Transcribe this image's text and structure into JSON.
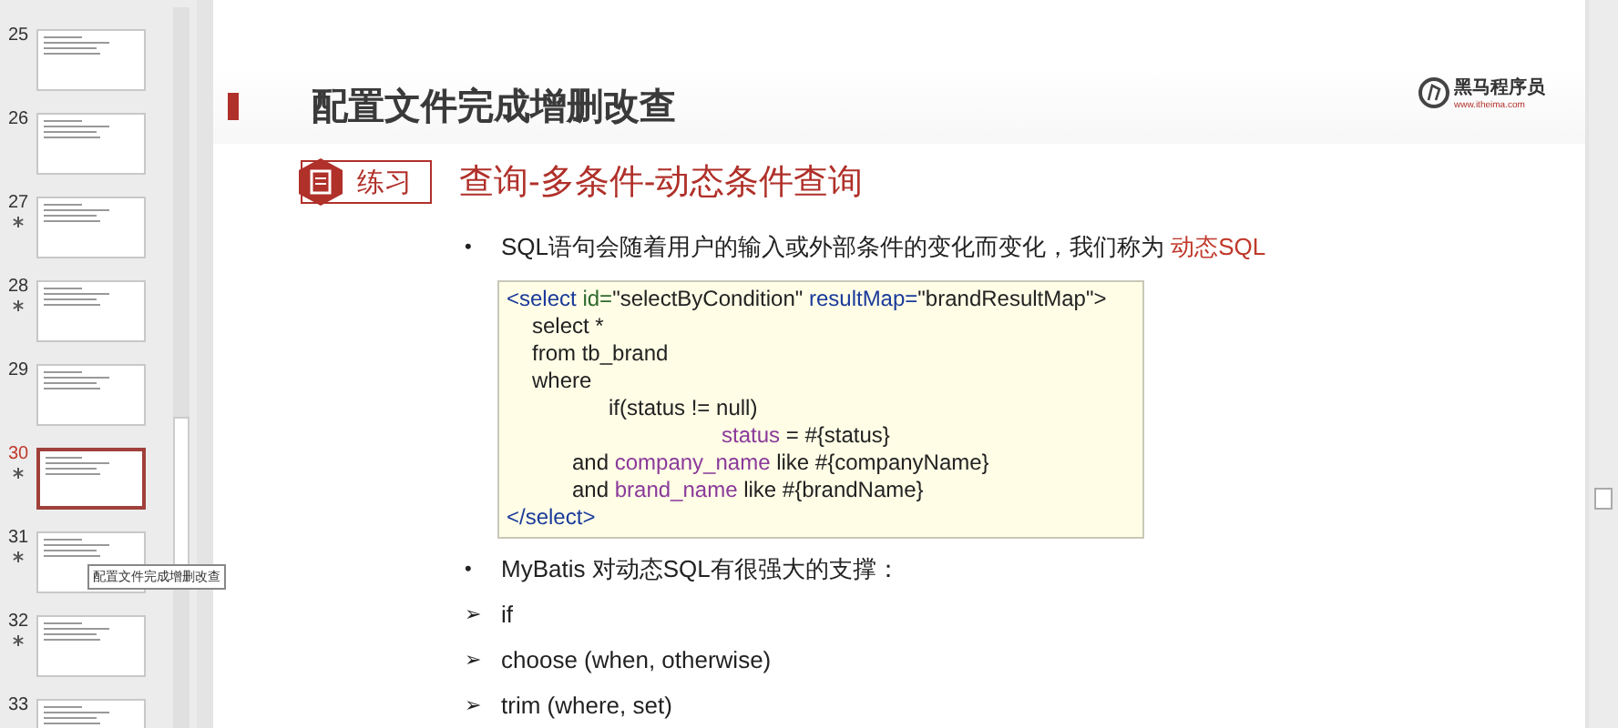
{
  "thumbnails": [
    {
      "number": "25",
      "starred": false,
      "selected": false
    },
    {
      "number": "26",
      "starred": false,
      "selected": false
    },
    {
      "number": "27",
      "starred": true,
      "selected": false
    },
    {
      "number": "28",
      "starred": true,
      "selected": false
    },
    {
      "number": "29",
      "starred": false,
      "selected": false
    },
    {
      "number": "30",
      "starred": true,
      "selected": true
    },
    {
      "number": "31",
      "starred": true,
      "selected": false
    },
    {
      "number": "32",
      "starred": true,
      "selected": false
    },
    {
      "number": "33",
      "starred": false,
      "selected": false
    }
  ],
  "tooltip": "配置文件完成增删改查",
  "slide": {
    "title": "配置文件完成增删改查",
    "logo": {
      "name": "黑马程序员",
      "url": "www.itheima.com"
    },
    "badge": "练习",
    "subtitle": "查询-多条件-动态条件查询",
    "intro": "SQL语句会随着用户的输入或外部条件的变化而变化，我们称为 ",
    "intro_highlight": "动态SQL",
    "code": [
      {
        "kind": "tag",
        "parts": [
          {
            "kind": "keyword",
            "text": "<select "
          },
          {
            "kind": "attr",
            "text": "id="
          },
          {
            "kind": "plain",
            "text": "\"selectByCondition\" "
          },
          {
            "kind": "keyword",
            "text": "resultMap="
          },
          {
            "kind": "plain",
            "text": "\"brandResultMap\">"
          }
        ]
      },
      {
        "kind": "body",
        "parts": [
          {
            "kind": "plain",
            "text": "select *"
          }
        ]
      },
      {
        "kind": "body",
        "parts": [
          {
            "kind": "plain",
            "text": "from tb_brand"
          }
        ]
      },
      {
        "kind": "body",
        "parts": [
          {
            "kind": "plain",
            "text": "where"
          }
        ]
      },
      {
        "kind": "condition",
        "parts": [
          {
            "kind": "plain",
            "text": "if(status != null)"
          }
        ]
      },
      {
        "kind": "value",
        "parts": [
          {
            "kind": "field",
            "text": "status"
          },
          {
            "kind": "plain",
            "text": " = #{status}"
          }
        ]
      },
      {
        "kind": "clause",
        "parts": [
          {
            "kind": "plain",
            "text": "and "
          },
          {
            "kind": "field",
            "text": "company_name"
          },
          {
            "kind": "plain",
            "text": " like #{companyName}"
          }
        ]
      },
      {
        "kind": "clause",
        "parts": [
          {
            "kind": "plain",
            "text": "and "
          },
          {
            "kind": "field",
            "text": "brand_name"
          },
          {
            "kind": "plain",
            "text": " like #{brandName}"
          }
        ]
      },
      {
        "kind": "tag",
        "parts": [
          {
            "kind": "keyword",
            "text": "</select>"
          }
        ]
      }
    ],
    "bullets": [
      {
        "marker": "•",
        "text": "MyBatis 对动态SQL有很强大的支撑："
      },
      {
        "marker": "➢",
        "text": "if"
      },
      {
        "marker": "➢",
        "text": "choose (when, otherwise)"
      },
      {
        "marker": "➢",
        "text": "trim (where, set)"
      }
    ]
  }
}
